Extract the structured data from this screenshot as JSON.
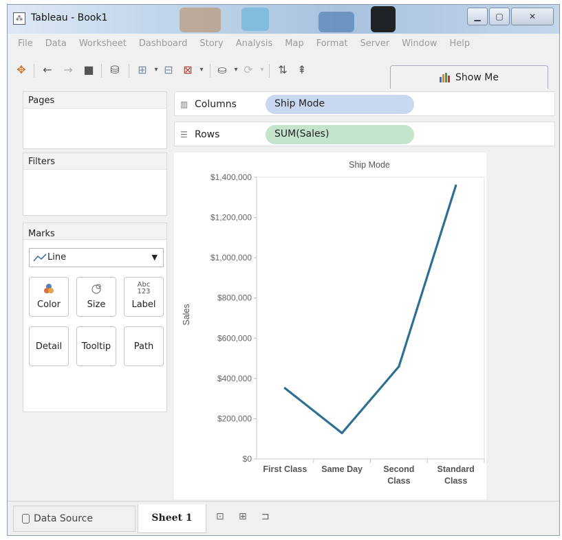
{
  "window": {
    "title": "Tableau - Book1"
  },
  "menu": [
    "File",
    "Data",
    "Worksheet",
    "Dashboard",
    "Story",
    "Analysis",
    "Map",
    "Format",
    "Server",
    "Window",
    "Help"
  ],
  "toolbar": {
    "show_me_label": "Show Me"
  },
  "panes": {
    "pages": "Pages",
    "filters": "Filters",
    "marks": "Marks"
  },
  "marks": {
    "type": "Line",
    "cards": {
      "color": "Color",
      "size": "Size",
      "label": "Label",
      "label_icon": "Abc\n123",
      "detail": "Detail",
      "tooltip": "Tooltip",
      "path": "Path"
    }
  },
  "shelves": {
    "columns": {
      "label": "Columns",
      "pill": "Ship Mode"
    },
    "rows": {
      "label": "Rows",
      "pill": "SUM(Sales)"
    }
  },
  "colors": {
    "line": "#2e6f92",
    "dimension_pill": "#c8d8f0",
    "measure_pill": "#c5e4cc"
  },
  "chart_data": {
    "type": "line",
    "title": "Ship Mode",
    "ylabel": "Sales",
    "xlabel": "",
    "categories": [
      [
        "First Class"
      ],
      [
        "Same Day"
      ],
      [
        "Second",
        "Class"
      ],
      [
        "Standard",
        "Class"
      ]
    ],
    "values": [
      351400,
      128400,
      459200,
      1358200
    ],
    "ylim": [
      0,
      1400000
    ],
    "yticks": [
      0,
      200000,
      400000,
      600000,
      800000,
      1000000,
      1200000,
      1400000
    ],
    "ytick_labels": [
      "$0",
      "$200,000",
      "$400,000",
      "$600,000",
      "$800,000",
      "$1,000,000",
      "$1,200,000",
      "$1,400,000"
    ],
    "grid": false
  },
  "bottom": {
    "data_source": "Data Source",
    "sheet": "Sheet 1"
  }
}
